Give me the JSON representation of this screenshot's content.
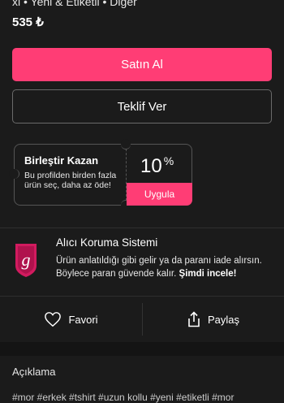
{
  "product": {
    "meta": "xl • Yeni & Etiketli • Diğer",
    "price": "535 ₺"
  },
  "actions": {
    "buy_label": "Satın Al",
    "offer_label": "Teklif Ver"
  },
  "coupon": {
    "title": "Birleştir Kazan",
    "description": "Bu profilden birden fazla ürün seç, daha az öde!",
    "percent_value": "10",
    "percent_sign": "%",
    "apply_label": "Uygula"
  },
  "protection": {
    "title": "Alıcı Koruma Sistemi",
    "text": "Ürün anlatıldığı gibi gelir ya da paranı iade alırsın. Böylece paran güvende kalır.",
    "link": "Şimdi incele!",
    "icon": "shield-g-icon",
    "icon_letter": "g"
  },
  "bottom_actions": {
    "favorite_label": "Favori",
    "share_label": "Paylaş"
  },
  "description": {
    "title": "Açıklama",
    "tags_partial": "#mor #erkek #tshirt #uzun kollu #yeni #etiketli #mor"
  },
  "colors": {
    "accent": "#ff3d75",
    "background": "#1b1b1b"
  }
}
